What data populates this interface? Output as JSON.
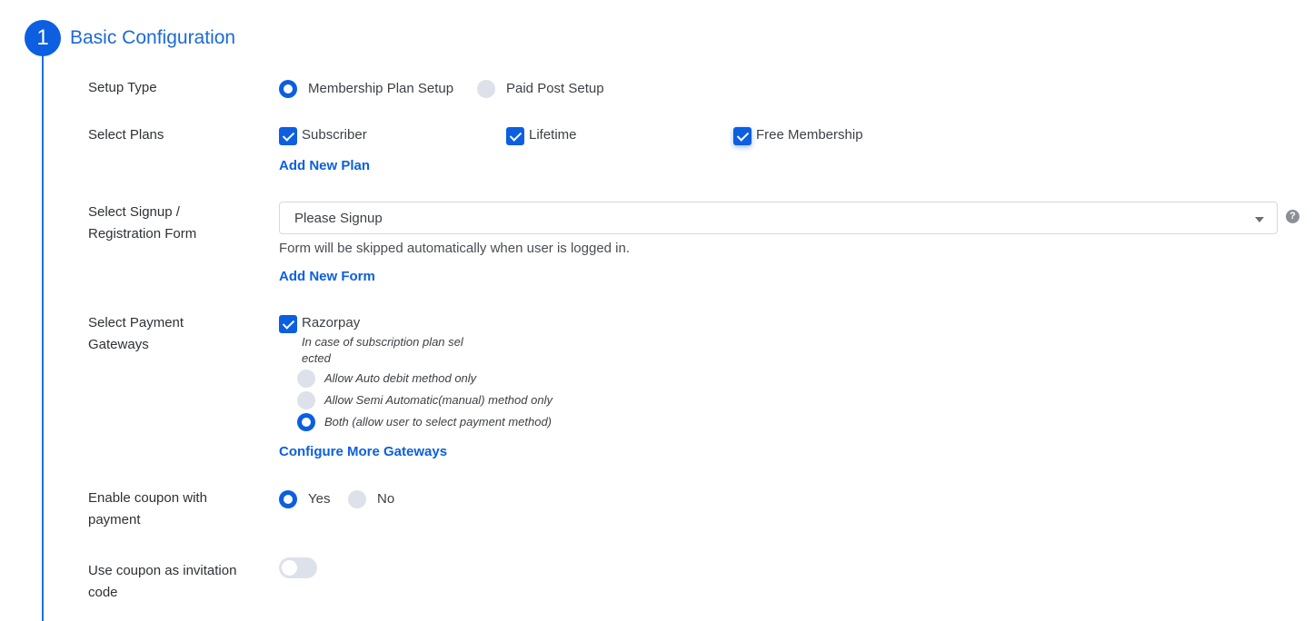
{
  "step": {
    "number": "1",
    "title": "Basic Configuration"
  },
  "setup_type": {
    "label": "Setup Type",
    "options": [
      {
        "label": "Membership Plan Setup",
        "selected": true
      },
      {
        "label": "Paid Post Setup",
        "selected": false
      }
    ]
  },
  "select_plans": {
    "label": "Select Plans",
    "plans": [
      {
        "label": "Subscriber",
        "checked": true
      },
      {
        "label": "Lifetime",
        "checked": true
      },
      {
        "label": "Free Membership",
        "checked": true
      }
    ],
    "add_link": "Add New Plan"
  },
  "signup_form": {
    "label_line1": "Select Signup /",
    "label_line2": "Registration Form",
    "selected_value": "Please Signup",
    "help_icon_glyph": "?",
    "hint": "Form will be skipped automatically when user is logged in.",
    "add_link": "Add New Form"
  },
  "payment_gateways": {
    "label_line1": "Select Payment",
    "label_line2": "Gateways",
    "gateways": [
      {
        "label": "Razorpay",
        "checked": true
      }
    ],
    "note_line1": "In case of subscription plan sel",
    "note_line2": "ected",
    "methods": [
      {
        "label": "Allow Auto debit method only",
        "selected": false
      },
      {
        "label": "Allow Semi Automatic(manual) method only",
        "selected": false
      },
      {
        "label": "Both (allow user to select payment method)",
        "selected": true
      }
    ],
    "configure_link": "Configure More Gateways"
  },
  "coupon": {
    "label_line1": "Enable coupon with",
    "label_line2": "payment",
    "options": [
      {
        "label": "Yes",
        "selected": true
      },
      {
        "label": "No",
        "selected": false
      }
    ]
  },
  "invitation": {
    "label_line1": "Use coupon as invitation",
    "label_line2": "code",
    "enabled": false
  },
  "colors": {
    "accent": "#0b5fe0",
    "title": "#1a6ad8",
    "inactive": "#dde1ea"
  }
}
